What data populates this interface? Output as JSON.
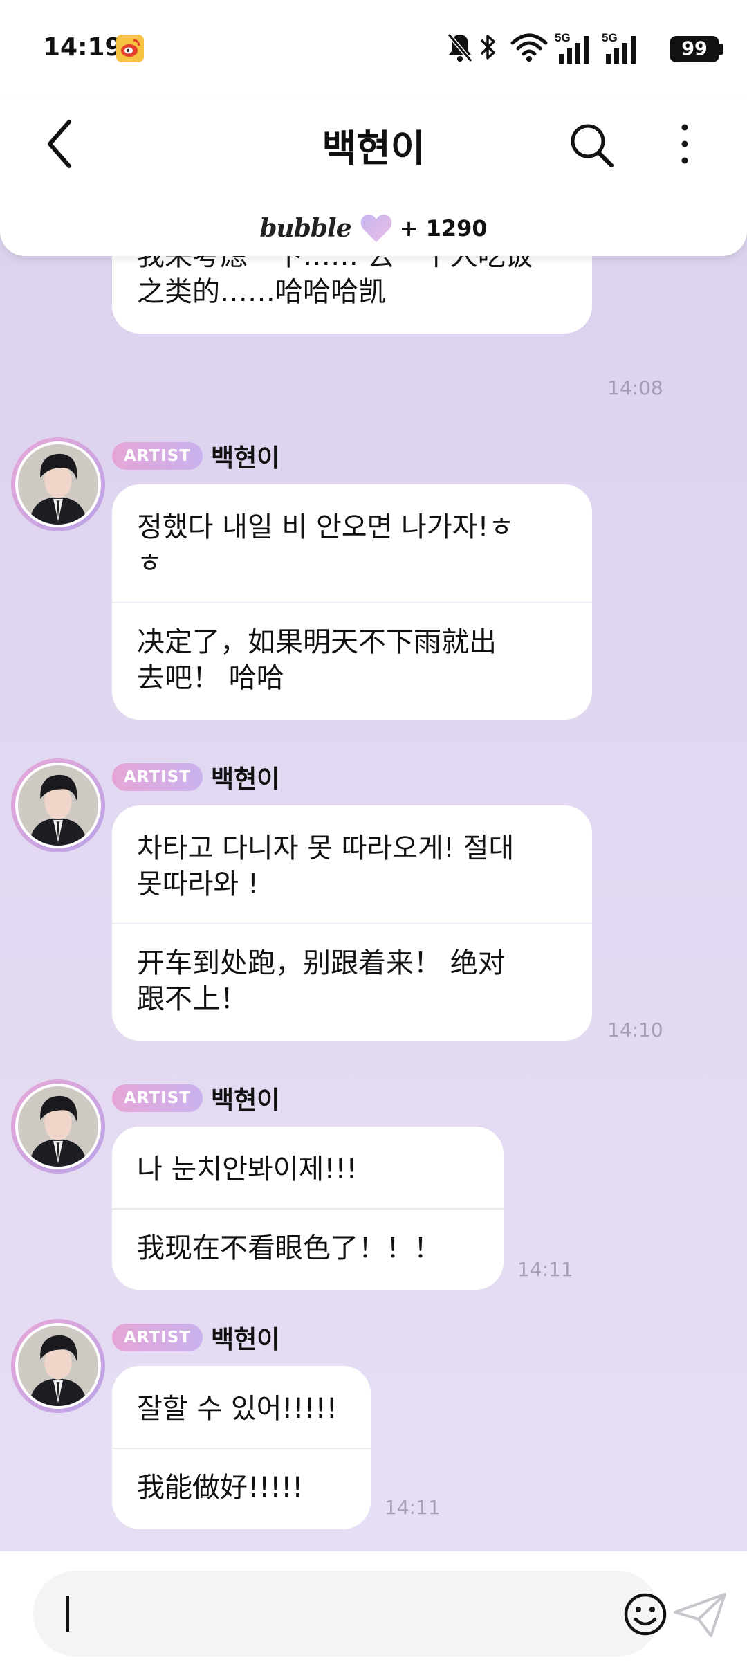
{
  "status_bar": {
    "time": "14:19",
    "battery": "99",
    "network_labels": [
      "5G",
      "5G"
    ]
  },
  "header": {
    "title": "백현이",
    "bubble_logo": "bubble",
    "bubble_count": "+ 1290"
  },
  "colors": {
    "chat_bg": "#ddd2ee",
    "badge_gradient_start": "#e6a4d6",
    "badge_gradient_end": "#c9b2ee",
    "timestamp": "#a79fb6"
  },
  "messages": [
    {
      "partial": true,
      "ko": "",
      "zh": "我来考虑一下…… 去一个人吃饭\n之类的……哈哈哈凯",
      "time": "14:08"
    },
    {
      "badge": "ARTIST",
      "name": "백현이",
      "ko": "정했다 내일 비 안오면 나가자!ㅎ\nㅎ",
      "zh": "决定了，如果明天不下雨就出\n去吧！ 哈哈",
      "time": ""
    },
    {
      "badge": "ARTIST",
      "name": "백현이",
      "ko": "차타고 다니자 못 따라오게! 절대\n못따라와 !",
      "zh": "开车到处跑，别跟着来！ 绝对\n跟不上！",
      "time": "14:10"
    },
    {
      "badge": "ARTIST",
      "name": "백현이",
      "ko": "나 눈치안봐이제!!!",
      "zh": "我现在不看眼色了！！！",
      "time": "14:11"
    },
    {
      "badge": "ARTIST",
      "name": "백현이",
      "ko": "잘할 수 있어!!!!!",
      "zh": "我能做好!!!!!",
      "time": "14:11"
    }
  ],
  "input": {
    "value": ""
  }
}
